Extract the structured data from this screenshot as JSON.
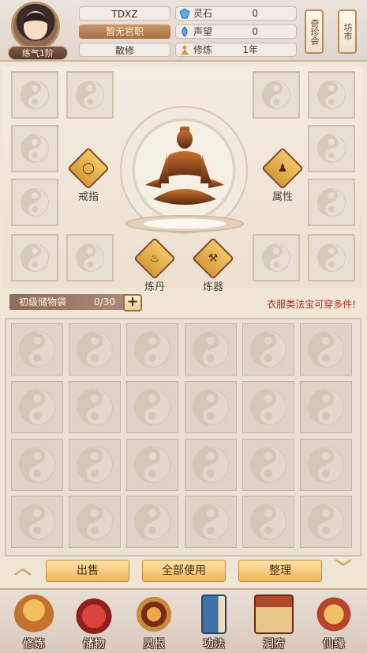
{
  "player": {
    "name": "TDXZ",
    "level": "练气1阶",
    "office": "暂无官职",
    "sect": "散修"
  },
  "stats": [
    {
      "label": "灵石",
      "value": "0",
      "icon": "spirit-stone-icon"
    },
    {
      "label": "声望",
      "value": "0",
      "icon": "reputation-icon"
    },
    {
      "label": "修炼",
      "value": "1年",
      "icon": "cultivation-icon"
    }
  ],
  "shops": [
    {
      "label": "奇珍会",
      "icon": "scroll-icon"
    },
    {
      "label": "坊市",
      "icon": "scroll-icon"
    }
  ],
  "functions": {
    "ring": "戒指",
    "attributes": "属性",
    "alchemy": "炼丹",
    "forging": "炼器"
  },
  "bag": {
    "name": "初级储物袋",
    "count": "0/30",
    "add_label": "+",
    "tip": "衣服类法宝可穿多件!"
  },
  "actions": {
    "sell": "出售",
    "use_all": "全部使用",
    "organize": "整理"
  },
  "nav": [
    {
      "label": "修炼",
      "icon": "cultivate-icon"
    },
    {
      "label": "储物",
      "icon": "storage-bag-icon"
    },
    {
      "label": "灵根",
      "icon": "spirit-root-icon"
    },
    {
      "label": "功法",
      "icon": "technique-book-icon"
    },
    {
      "label": "洞府",
      "icon": "cave-mansion-icon"
    },
    {
      "label": "仙缘",
      "icon": "immortal-fate-icon"
    }
  ],
  "colors": {
    "accent_gold": "#f0b95c",
    "tip_red": "#b8271a",
    "panel_bg": "#efe6d8"
  }
}
